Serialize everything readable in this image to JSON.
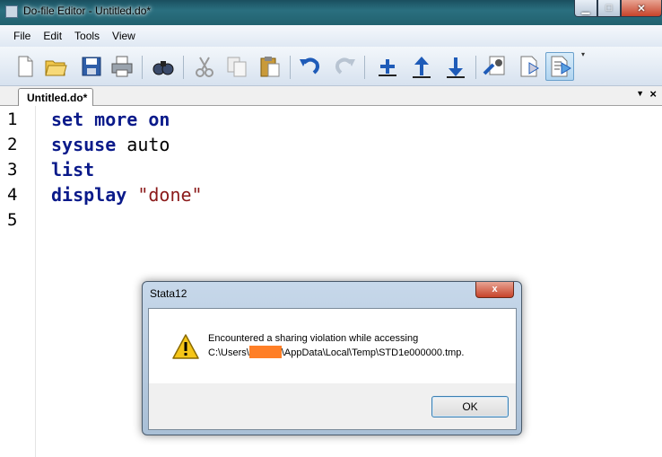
{
  "window": {
    "title": "Do-file Editor - Untitled.do*"
  },
  "menu": [
    "File",
    "Edit",
    "Tools",
    "View"
  ],
  "toolbar": {
    "icons": [
      "new-file-icon",
      "open-folder-icon",
      "save-icon",
      "print-icon",
      "find-icon",
      "cut-icon",
      "copy-icon",
      "paste-icon",
      "undo-icon",
      "redo-icon",
      "toggle-bookmark-icon",
      "previous-bookmark-icon",
      "next-bookmark-icon",
      "show-file-icon",
      "execute-quietly-icon",
      "execute-do-icon"
    ]
  },
  "tab": {
    "label": "Untitled.do*"
  },
  "editor": {
    "lines": [
      {
        "num": "1",
        "kw": "set more on",
        "rest": ""
      },
      {
        "num": "2",
        "kw": "sysuse",
        "rest": " auto"
      },
      {
        "num": "3",
        "kw": "list",
        "rest": ""
      },
      {
        "num": "4",
        "kw": "display",
        "rest": " ",
        "str": "\"done\""
      },
      {
        "num": "5",
        "kw": "",
        "rest": ""
      }
    ]
  },
  "dialog": {
    "title": "Stata12",
    "message_line1": "Encountered a sharing violation while accessing",
    "path_prefix": "C:\\Users\\",
    "path_suffix": "\\AppData\\Local\\Temp\\STD1e000000.tmp.",
    "ok_label": "OK",
    "close_label": "x",
    "redaction_color": "#ff7f27"
  },
  "colors": {
    "keyword": "#0a1a8a",
    "string": "#8b1a1a"
  }
}
